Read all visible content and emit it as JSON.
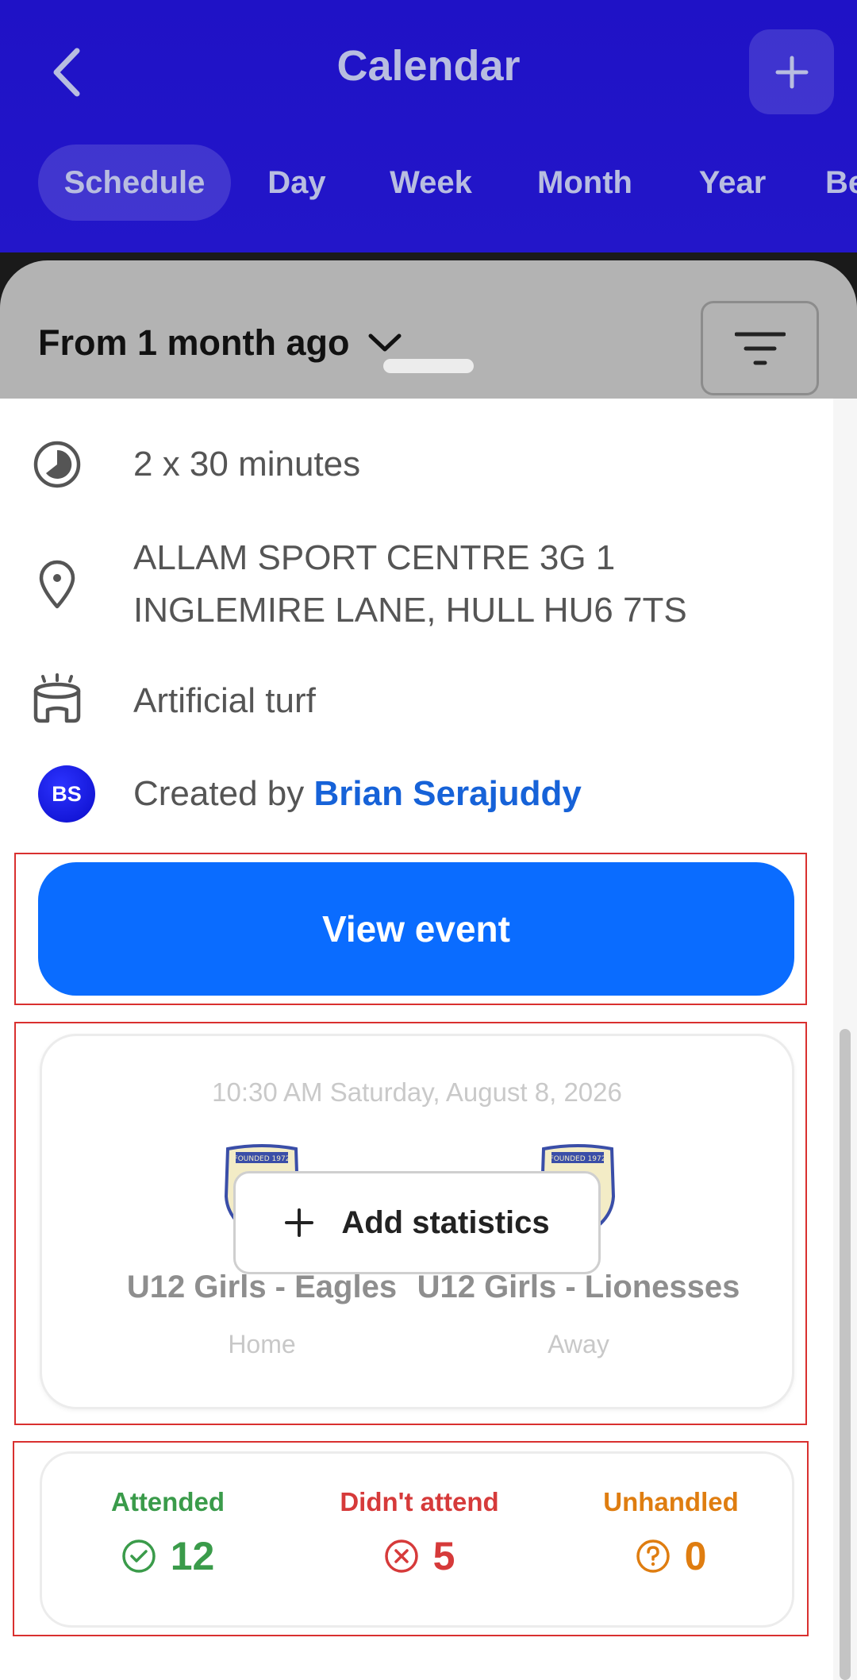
{
  "header": {
    "title": "Calendar",
    "tabs": [
      {
        "label": "Schedule",
        "active": true
      },
      {
        "label": "Day",
        "active": false
      },
      {
        "label": "Week",
        "active": false
      },
      {
        "label": "Month",
        "active": false
      },
      {
        "label": "Year",
        "active": false
      },
      {
        "label": "Be",
        "active": false
      }
    ]
  },
  "filter_bar": {
    "range_label": "From 1 month ago"
  },
  "event_details": {
    "duration": "2 x 30 minutes",
    "location_line1": "ALLAM SPORT CENTRE 3G 1",
    "location_line2": "INGLEMIRE LANE, HULL HU6 7TS",
    "surface": "Artificial turf",
    "creator_prefix": "Created by ",
    "creator_name": "Brian Serajuddy",
    "creator_initials": "BS"
  },
  "view_event_label": "View event",
  "match": {
    "datetime": "10:30 AM Saturday, August 8, 2026",
    "home_team": "U12 Girls - Eagles",
    "home_role": "Home",
    "away_team": "U12 Girls - Lionesses",
    "away_role": "Away",
    "add_statistics_label": "Add statistics",
    "crest_text": "FOUNDED 1972"
  },
  "attendance": {
    "attended_label": "Attended",
    "attended_count": "12",
    "not_attended_label": "Didn't attend",
    "not_attended_count": "5",
    "unhandled_label": "Unhandled",
    "unhandled_count": "0"
  },
  "colors": {
    "header_bg": "#1f12c6",
    "primary_button": "#0a6cff",
    "link": "#1662d8",
    "attended": "#3a9b4a",
    "not_attended": "#d63a3a",
    "unhandled": "#df7d10",
    "highlight_outline": "#d9302f"
  }
}
